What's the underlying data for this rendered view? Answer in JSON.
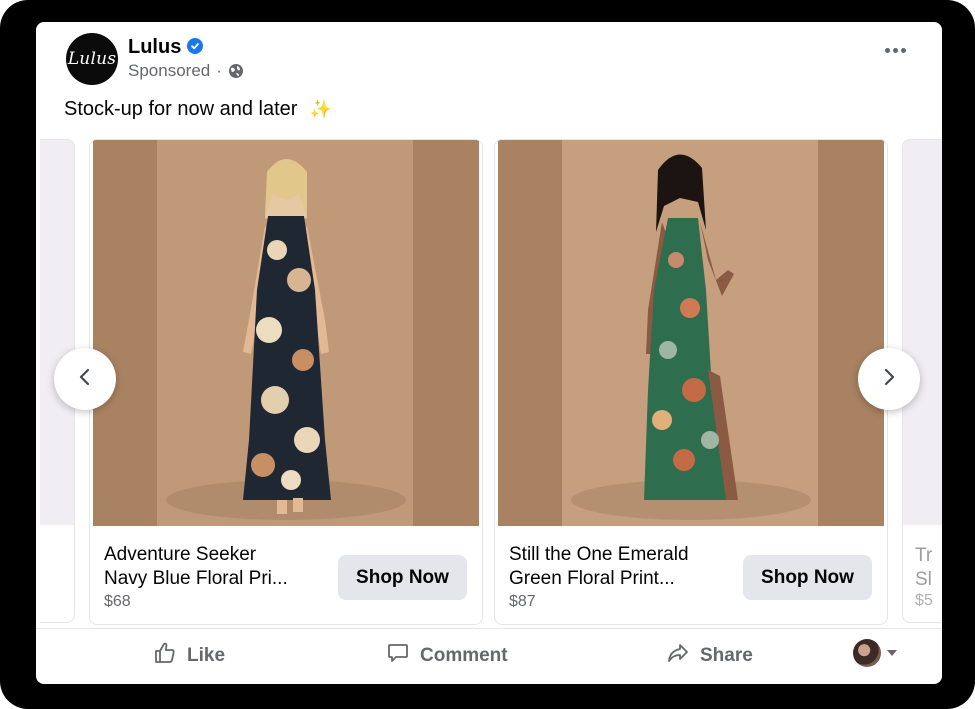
{
  "post": {
    "page_name": "Lulus",
    "avatar_text": "Lulus",
    "sponsored": "Sponsored",
    "separator": "·",
    "caption": "Stock-up for now and later",
    "caption_emoji": "sparkles-icon"
  },
  "carousel": {
    "cards": [
      {
        "title_line1": "Adventure Seeker",
        "title_line2": "Navy Blue Floral Pri...",
        "price": "$68",
        "button_label": "Shop Now",
        "dress_color": "#1f2733"
      },
      {
        "title_line1": "Still the One Emerald",
        "title_line2": "Green Floral Print...",
        "price": "$87",
        "button_label": "Shop Now",
        "dress_color": "#2f6d4f"
      }
    ],
    "peek_right": {
      "title_line1": "Tr",
      "title_line2": "Sl",
      "price": "$5"
    }
  },
  "actions": {
    "like": "Like",
    "comment": "Comment",
    "share": "Share"
  },
  "colors": {
    "accent": "#1877f2",
    "background_image": "#b38968"
  }
}
